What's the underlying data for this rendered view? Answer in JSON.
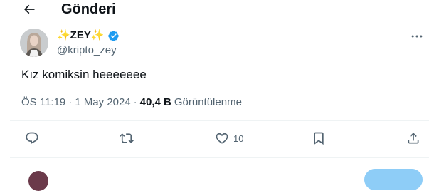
{
  "header": {
    "title": "Gönderi"
  },
  "post": {
    "author": {
      "display_name": "✨ZEY✨",
      "handle": "@kripto_zey"
    },
    "text": "Kız komiksin heeeeeee",
    "meta": {
      "time": "ÖS 11:19",
      "separator": "·",
      "date": "1 May 2024",
      "views_count": "40,4 B",
      "views_label": "Görüntülenme"
    },
    "actions": {
      "like_count": "10"
    }
  },
  "colors": {
    "verified": "#1d9bf0",
    "muted_text": "#536471",
    "divider": "#eff3f4",
    "reply_button": "#8ecdf7"
  }
}
